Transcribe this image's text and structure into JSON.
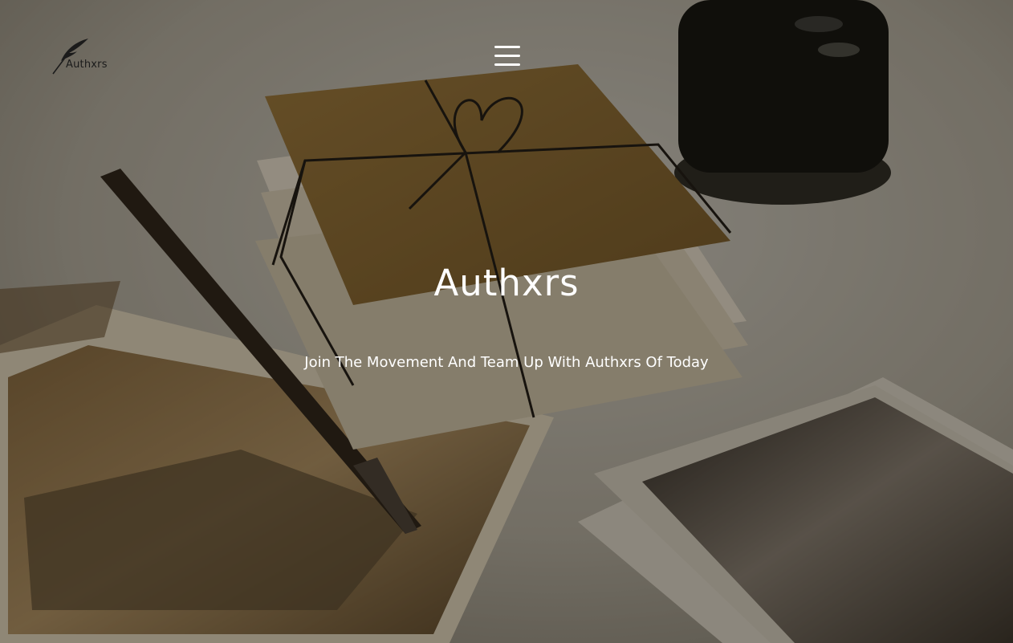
{
  "header": {
    "logo_text": "Authxrs",
    "logo_icon": "quill-feather-icon",
    "menu_icon": "hamburger-menu-icon"
  },
  "hero": {
    "title": "Authxrs",
    "subtitle": "Join The Movement And Team Up With Authxrs Of Today",
    "background_image": "letters-pen-photographs-desk"
  },
  "colors": {
    "overlay": "#14100a",
    "text": "#ffffff",
    "logo_text": "#1b1b1b"
  }
}
